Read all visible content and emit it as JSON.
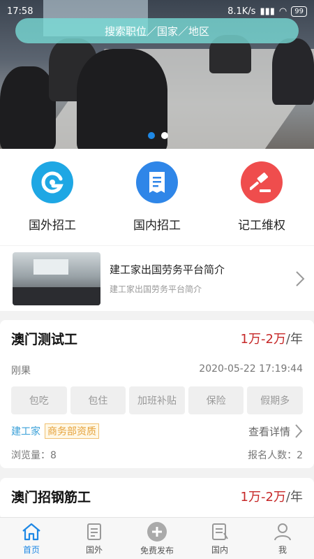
{
  "status_bar": {
    "time": "17:58",
    "speed": "8.1K/s",
    "battery": "99"
  },
  "search": {
    "placeholder": "搜索职位／国家／地区"
  },
  "categories": [
    {
      "label": "国外招工",
      "icon": "g-logo-icon",
      "color": "#1ea7e4"
    },
    {
      "label": "国内招工",
      "icon": "receipt-icon",
      "color": "#2f86e8"
    },
    {
      "label": "记工维权",
      "icon": "gavel-icon",
      "color": "#ef4d4d"
    }
  ],
  "intro": {
    "title": "建工家出国劳务平台简介",
    "subtitle": "建工家出国劳务平台简介"
  },
  "jobs": [
    {
      "title": "澳门测试工",
      "salary": "1万-2万",
      "salary_unit": "/年",
      "posted_label": "刚果",
      "date": "2020-05-22 17:19:44",
      "tags": [
        "包吃",
        "包住",
        "加班补贴",
        "保险",
        "假期多"
      ],
      "source": "建工家",
      "badge": "商务部资质",
      "detail_label": "查看详情",
      "views": "浏览量：8",
      "signups": "报名人数：2"
    },
    {
      "title": "澳门招钢筋工",
      "salary": "1万-2万",
      "salary_unit": "/年"
    }
  ],
  "nav": [
    {
      "label": "首页",
      "icon": "home-icon",
      "active": true
    },
    {
      "label": "国外",
      "icon": "document-icon",
      "active": false
    },
    {
      "label": "免费发布",
      "icon": "plus-circle-icon",
      "active": false
    },
    {
      "label": "国内",
      "icon": "list-doc-icon",
      "active": false
    },
    {
      "label": "我",
      "icon": "user-icon",
      "active": false
    }
  ],
  "colors": {
    "accent": "#1e88e5",
    "salary": "#c62828",
    "source": "#3aa0d8",
    "badge": "#e6a23c"
  }
}
